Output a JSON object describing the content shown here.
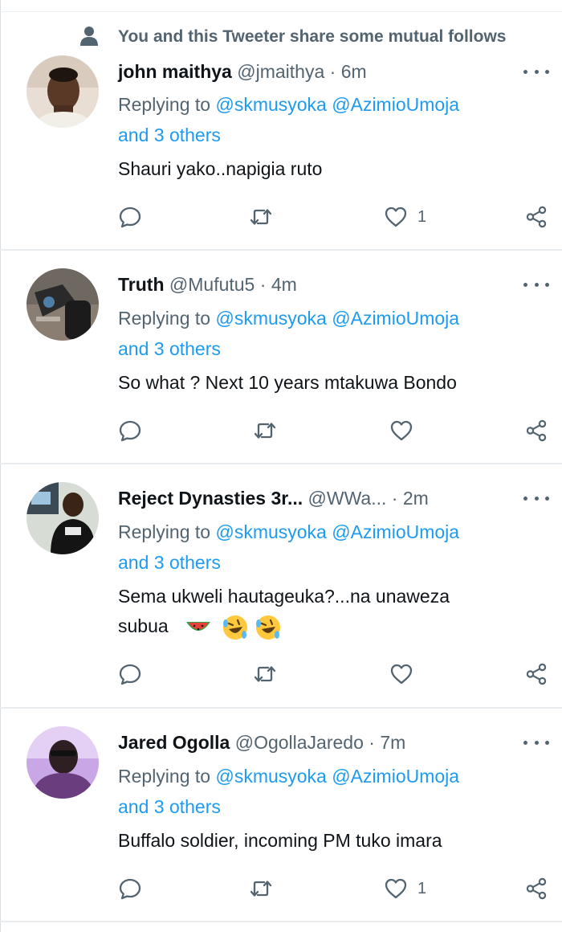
{
  "social_context": {
    "icon": "person-icon",
    "text": "You and this Tweeter share some mutual follows"
  },
  "tweets": [
    {
      "name": "john maithya",
      "handle": "@jmaithya",
      "separator": "·",
      "time": "6m",
      "replying_prefix": "Replying to",
      "mentions": [
        "@skmusyoka",
        "@AzimioUmoja"
      ],
      "others": "and 3 others",
      "text": "Shauri yako..napigia ruto",
      "emojis": [],
      "like_count": "1"
    },
    {
      "name": "Truth",
      "handle": "@Mufutu5",
      "separator": "·",
      "time": "4m",
      "replying_prefix": "Replying to",
      "mentions": [
        "@skmusyoka",
        "@AzimioUmoja"
      ],
      "others": "and 3 others",
      "text": "So what ? Next 10 years mtakuwa Bondo",
      "emojis": [],
      "like_count": ""
    },
    {
      "name": "Reject Dynasties 3r...",
      "handle": "@WWa...",
      "separator": "·",
      "time": "2m",
      "replying_prefix": "Replying to",
      "mentions": [
        "@skmusyoka",
        "@AzimioUmoja"
      ],
      "others": "and 3 others",
      "text_line1": "Sema ukweli hautageuka?...na unaweza",
      "text_line2": "subua",
      "emojis": [
        "watermelon",
        "rolling-on-the-floor-laughing",
        "rolling-on-the-floor-laughing"
      ],
      "like_count": ""
    },
    {
      "name": "Jared Ogolla",
      "handle": "@OgollaJaredo",
      "separator": "·",
      "time": "7m",
      "replying_prefix": "Replying to",
      "mentions": [
        "@skmusyoka",
        "@AzimioUmoja"
      ],
      "others": "and 3 others",
      "text": "Buffalo soldier, incoming PM tuko imara",
      "emojis": [],
      "like_count": "1"
    }
  ],
  "icons": {
    "reply": "reply-icon",
    "retweet": "retweet-icon",
    "like": "heart-icon",
    "share": "share-icon",
    "more": "more-options-icon"
  },
  "colors": {
    "mention": "#1d9bf0",
    "secondary_text": "#536471",
    "primary_text": "#0f1419",
    "divider": "#e8ecef"
  }
}
